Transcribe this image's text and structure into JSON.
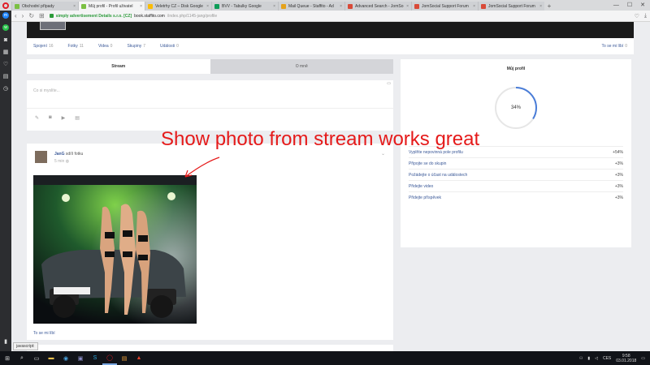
{
  "browser": {
    "tabs": [
      {
        "label": "Obchodní případy",
        "color": "#7bc043",
        "active": false
      },
      {
        "label": "Můj profil - Profil uživatel",
        "color": "#7bc043",
        "active": true
      },
      {
        "label": "Veletrhy CZ – Disk Google",
        "color": "#fbbc05",
        "active": false
      },
      {
        "label": "BVV - Tabulky Google",
        "color": "#0f9d58",
        "active": false
      },
      {
        "label": "Mail Queue - Staffito - Ad",
        "color": "#e5a21b",
        "active": false
      },
      {
        "label": "Advanced Search - JomSo",
        "color": "#d94a38",
        "active": false
      },
      {
        "label": "JomSocial Support Forum",
        "color": "#d94a38",
        "active": false
      },
      {
        "label": "JomSocial Support Forum",
        "color": "#d94a38",
        "active": false
      }
    ],
    "new_tab": "+",
    "window_controls": [
      "—",
      "☐",
      "✕"
    ],
    "address": {
      "secure_label": "simply advertisement Details s.r.o. [CZ]",
      "domain": "book.staffito.com",
      "path": "/index.php/1145-jang/profile"
    },
    "status_url": "javascript:"
  },
  "sidebar_icons": [
    "messenger-icon",
    "whatsapp-icon",
    "camera-icon",
    "grid-icon",
    "heart-icon",
    "news-icon",
    "history-icon"
  ],
  "profile": {
    "stats": [
      {
        "label": "Spojení",
        "count": "16"
      },
      {
        "label": "Fotky",
        "count": "11"
      },
      {
        "label": "Videa",
        "count": "0"
      },
      {
        "label": "Skupiny",
        "count": "7"
      },
      {
        "label": "Události",
        "count": "0"
      }
    ],
    "like": {
      "label": "To se mi líbí",
      "count": "0"
    },
    "tabs": [
      "Stream",
      "O mně"
    ],
    "composer_placeholder": "Co si myslíte..."
  },
  "post": {
    "author": "JanG",
    "action": "sdílí fotku",
    "time": "5 min",
    "like_text": "To se mi líbí"
  },
  "my_profile": {
    "title": "Můj profil",
    "percent": 34,
    "percent_text": "34%",
    "tasks": [
      {
        "label": "Vyplňte nepovinná pole profilu",
        "value": "+54%"
      },
      {
        "label": "Připojte se do skupin",
        "value": "+3%"
      },
      {
        "label": "Požádejte o účast na událostech",
        "value": "+3%"
      },
      {
        "label": "Přidejte video",
        "value": "+3%"
      },
      {
        "label": "Přidejte příspěvek",
        "value": "+3%"
      }
    ]
  },
  "annotation": "Show photo from stream works great",
  "taskbar": {
    "lang": "CES",
    "time": "9:58",
    "date": "03.01.2018"
  }
}
